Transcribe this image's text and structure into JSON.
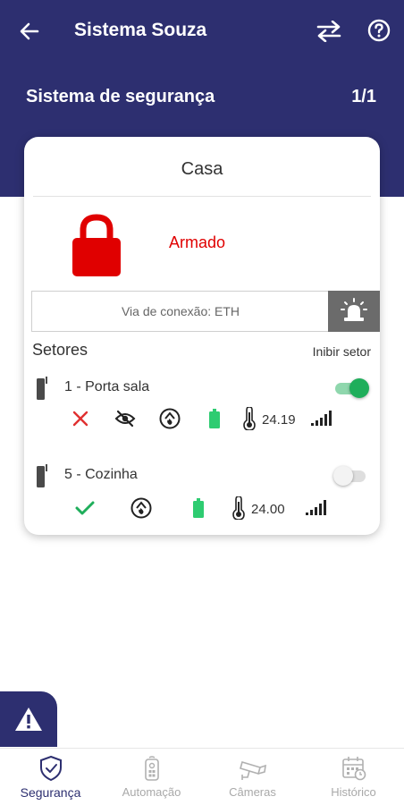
{
  "header": {
    "title": "Sistema Souza",
    "section_title": "Sistema de segurança",
    "pager": "1/1",
    "back_icon": "arrow-left-icon",
    "swap_icon": "swap-icon",
    "help_icon": "help-icon"
  },
  "panel": {
    "title": "Casa",
    "status": "Armado",
    "status_color": "#e00000",
    "lock_icon": "lock-icon",
    "connection_text": "Via de conexão: ETH",
    "siren_icon": "siren-icon"
  },
  "sectors": {
    "label": "Setores",
    "inhibit_label": "Inibir setor",
    "zones": [
      {
        "name": "1 - Porta sala",
        "enabled": true,
        "icons": [
          "x-icon",
          "eye-off-icon",
          "fire-icon",
          "battery-icon",
          "thermometer-icon",
          "signal-icon"
        ],
        "temperature": "24.19"
      },
      {
        "name": "5 - Cozinha",
        "enabled": false,
        "icons": [
          "check-icon",
          "fire-icon",
          "battery-icon",
          "thermometer-icon",
          "signal-icon"
        ],
        "temperature": "24.00"
      }
    ]
  },
  "alert_button_icon": "warning-icon",
  "nav": {
    "items": [
      {
        "label": "Segurança",
        "icon": "shield-check-icon",
        "active": true
      },
      {
        "label": "Automação",
        "icon": "remote-icon",
        "active": false
      },
      {
        "label": "Câmeras",
        "icon": "camera-icon",
        "active": false
      },
      {
        "label": "Histórico",
        "icon": "calendar-icon",
        "active": false
      }
    ]
  },
  "colors": {
    "primary": "#2d2f70",
    "alarm_red": "#e00000",
    "ok_green": "#1fae5b",
    "battery_green": "#2ecc71"
  }
}
